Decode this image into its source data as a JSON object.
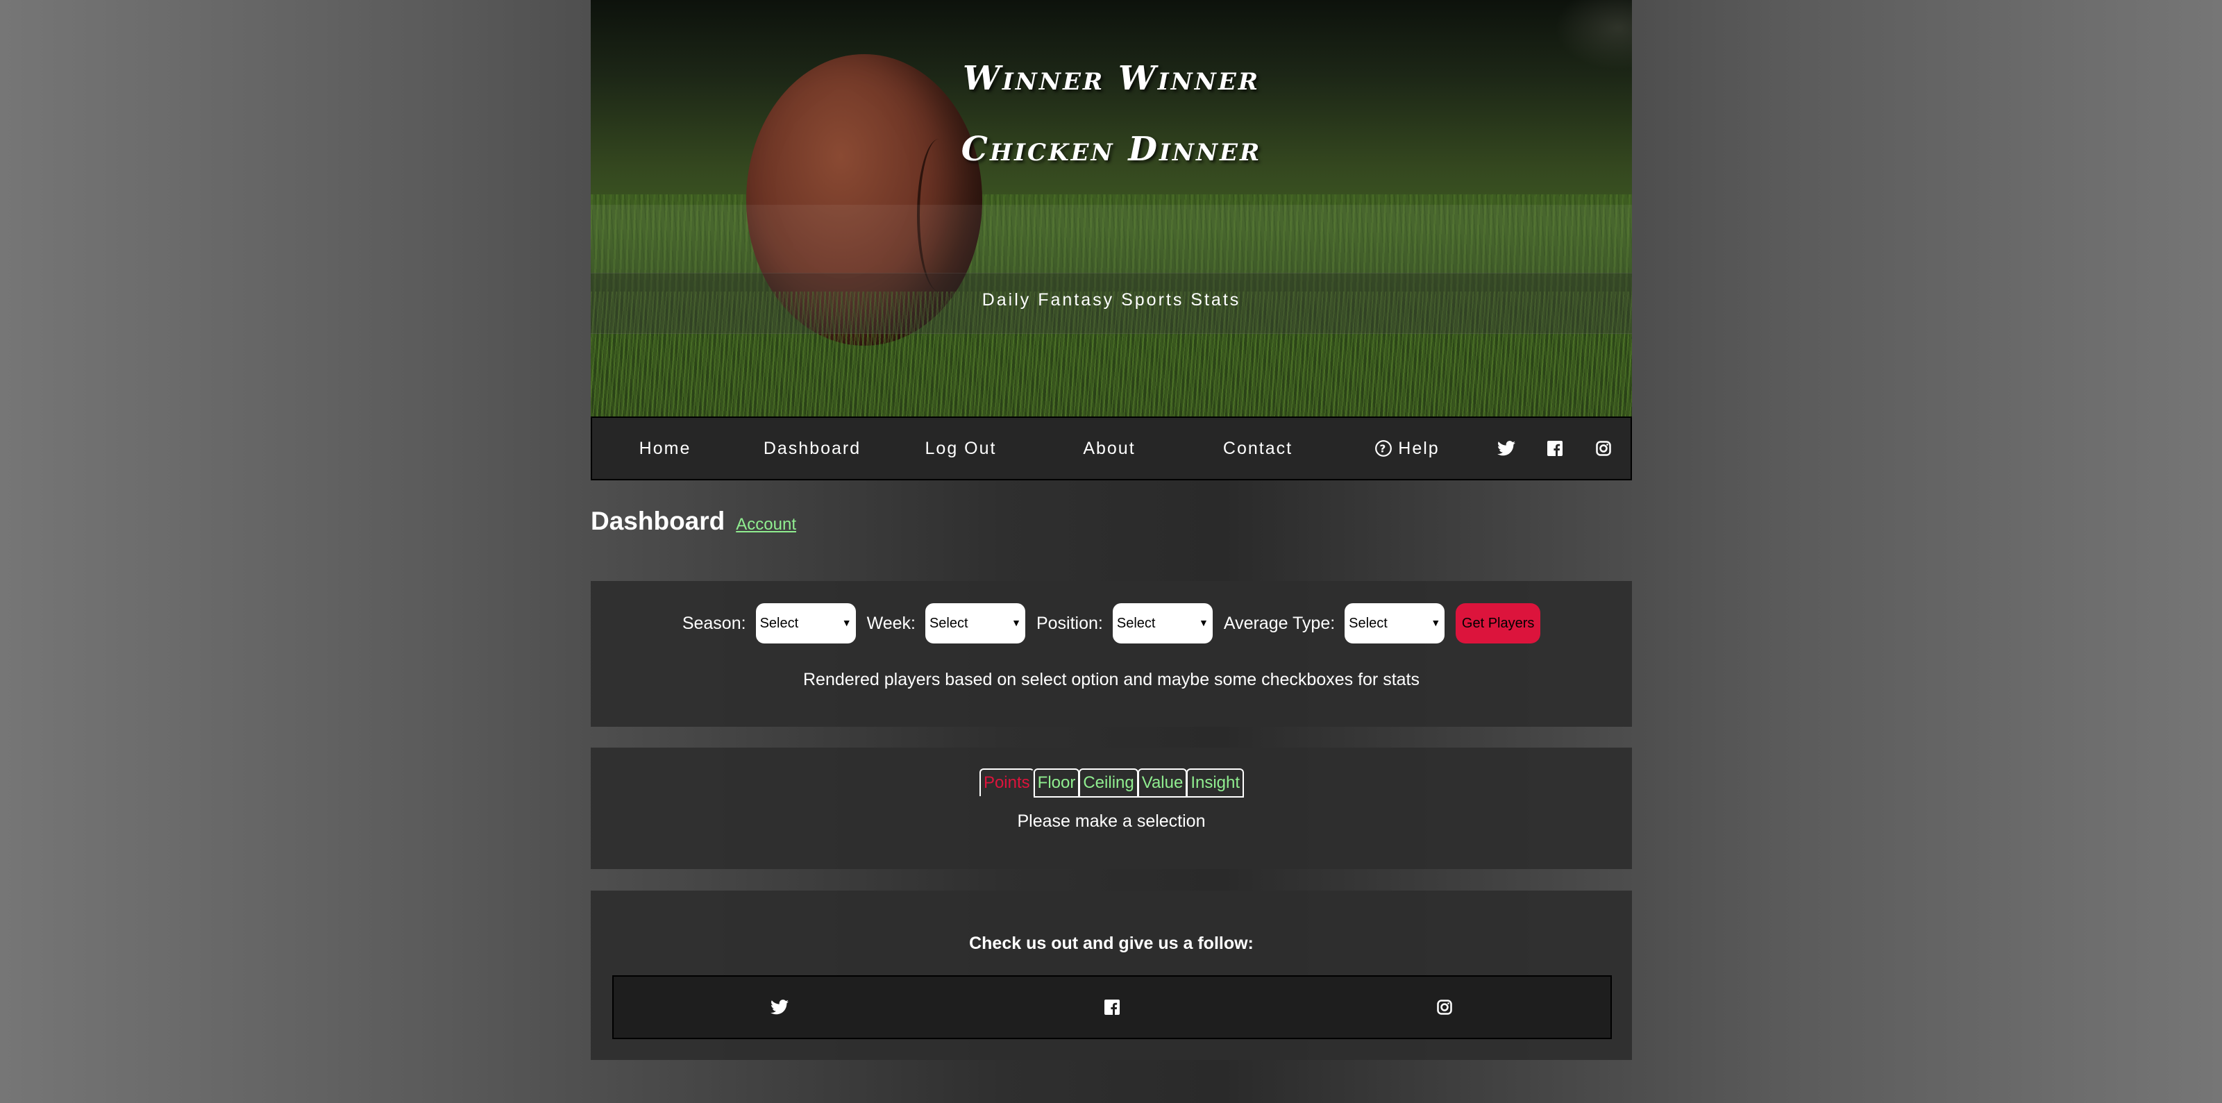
{
  "header": {
    "title_line1": "Winner Winner",
    "title_line2": "Chicken Dinner",
    "tagline": "Daily Fantasy Sports Stats"
  },
  "nav": {
    "items": [
      {
        "label": "Home"
      },
      {
        "label": "Dashboard"
      },
      {
        "label": "Log Out"
      },
      {
        "label": "About"
      },
      {
        "label": "Contact"
      },
      {
        "label": "Help",
        "icon": "help-circle-icon"
      }
    ],
    "social": [
      "twitter-icon",
      "facebook-icon",
      "instagram-icon"
    ]
  },
  "dashboard": {
    "title": "Dashboard",
    "account_link": "Account"
  },
  "filters": {
    "season_label": "Season:",
    "season_value": "Select",
    "week_label": "Week:",
    "week_value": "Select",
    "position_label": "Position:",
    "position_value": "Select",
    "average_type_label": "Average Type:",
    "average_type_value": "Select",
    "button": "Get Players",
    "note": "Rendered players based on select option and maybe some checkboxes for stats"
  },
  "tabs": {
    "items": [
      "Points",
      "Floor",
      "Ceiling",
      "Value",
      "Insight"
    ],
    "active": "Points",
    "note": "Please make a selection"
  },
  "footer": {
    "heading": "Check us out and give us a follow:",
    "social": [
      "twitter-icon",
      "facebook-icon",
      "instagram-icon"
    ]
  },
  "colors": {
    "accent_red": "#dc143c",
    "link_green": "#90ee90"
  }
}
